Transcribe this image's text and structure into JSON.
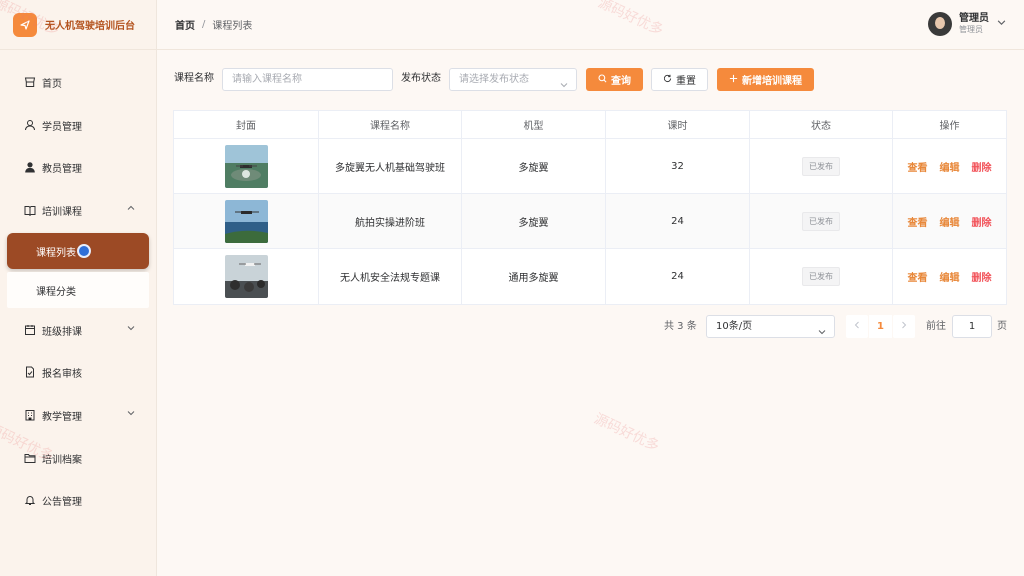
{
  "brand": {
    "title": "无人机驾驶培训后台"
  },
  "sidebar": {
    "items": [
      {
        "label": "首页",
        "icon": "shop-icon"
      },
      {
        "label": "学员管理",
        "icon": "user-icon"
      },
      {
        "label": "教员管理",
        "icon": "user-filled-icon"
      },
      {
        "label": "培训课程",
        "icon": "book-icon",
        "expanded": true
      },
      {
        "label": "班级排课",
        "icon": "calendar-icon"
      },
      {
        "label": "报名审核",
        "icon": "document-check-icon"
      },
      {
        "label": "教学管理",
        "icon": "building-icon"
      },
      {
        "label": "培训档案",
        "icon": "folder-icon"
      },
      {
        "label": "公告管理",
        "icon": "bell-icon"
      }
    ],
    "sub_items": [
      {
        "label": "课程列表",
        "active": true
      },
      {
        "label": "课程分类",
        "active": false
      }
    ]
  },
  "header": {
    "breadcrumb_home": "首页",
    "breadcrumb_sep": "/",
    "breadcrumb_current": "课程列表",
    "user_name": "管理员",
    "user_role": "管理员"
  },
  "search": {
    "name_label": "课程名称",
    "name_placeholder": "请输入课程名称",
    "status_label": "发布状态",
    "status_placeholder": "请选择发布状态",
    "query_label": "查询",
    "reset_label": "重置",
    "add_label": "新增培训课程"
  },
  "table": {
    "columns": [
      "封面",
      "课程名称",
      "机型",
      "课时",
      "状态",
      "操作"
    ],
    "rows": [
      {
        "name": "多旋翼无人机基础驾驶班",
        "model": "多旋翼",
        "hours": "32",
        "status": "已发布"
      },
      {
        "name": "航拍实操进阶班",
        "model": "多旋翼",
        "hours": "24",
        "status": "已发布"
      },
      {
        "name": "无人机安全法规专题课",
        "model": "通用多旋翼",
        "hours": "24",
        "status": "已发布"
      }
    ],
    "actions": {
      "view": "查看",
      "edit": "编辑",
      "delete": "删除"
    }
  },
  "pagination": {
    "total": "共 3 条",
    "page_size": "10条/页",
    "current_page": "1",
    "goto_label": "前往",
    "goto_value": "1",
    "page_suffix": "页"
  },
  "watermark": "源码好优多",
  "colors": {
    "accent": "#f58a3c",
    "active_menu": "#9c4a25",
    "danger": "#f2555c"
  }
}
